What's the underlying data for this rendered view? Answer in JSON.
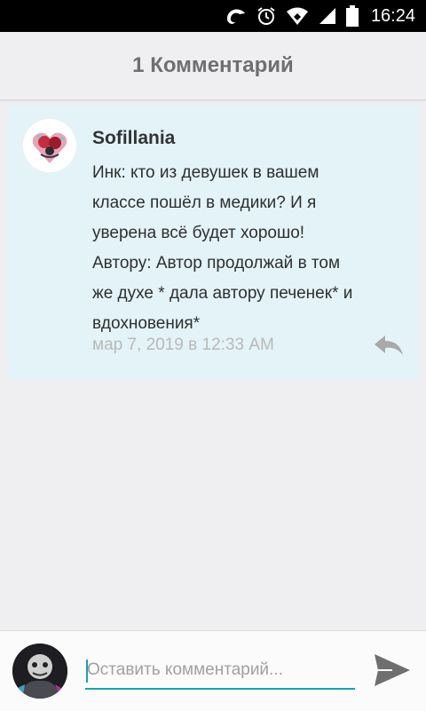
{
  "status_bar": {
    "time": "16:24",
    "icons": [
      "app-notification-icon",
      "alarm-icon",
      "wifi-icon",
      "signal-icon",
      "battery-icon"
    ]
  },
  "header": {
    "title": "1 Комментарий"
  },
  "comment": {
    "author": "Sofillania",
    "text": "Инк: кто из девушек в вашем\nклассе пошёл в медики? И я\nуверена всё будет хорошо!\nАвтору: Автор продолжай в том\nже духе * дала автору  печенек* и\nвдохновения*",
    "time": "мар 7, 2019 в 12:33 AM",
    "reply_icon": "reply-icon"
  },
  "composer": {
    "placeholder": "Оставить комментарий...",
    "value": "",
    "send_icon": "send-icon"
  },
  "colors": {
    "card_bg": "#e3f3f8",
    "accent": "#1aa3b0",
    "header_bg": "#efeef0"
  }
}
